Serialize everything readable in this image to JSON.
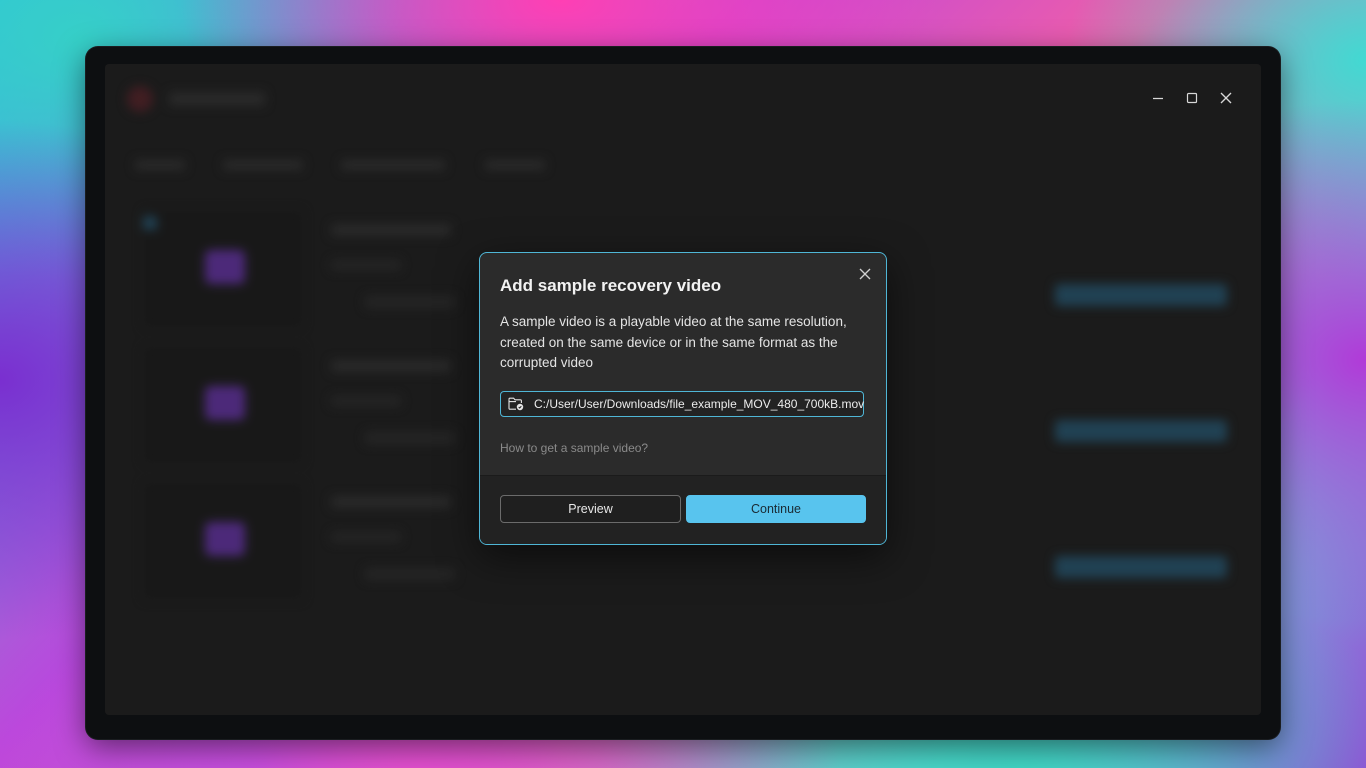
{
  "window": {
    "controls": {
      "minimize_icon": "minimize-icon",
      "maximize_icon": "maximize-icon",
      "close_icon": "close-icon"
    }
  },
  "dialog": {
    "title": "Add sample recovery video",
    "description": "A sample video is a playable video at the same resolution, created on the same device or in the same format as the corrupted video",
    "file_path": "C:/User/User/Downloads/file_example_MOV_480_700kB.mov",
    "help_link": "How to get a sample video?",
    "buttons": {
      "preview": "Preview",
      "continue": "Continue"
    }
  },
  "colors": {
    "accent": "#58c4ee",
    "dialog_border": "#4fb6d6",
    "window_bg": "#262626",
    "dialog_bg": "#2b2b2b"
  }
}
